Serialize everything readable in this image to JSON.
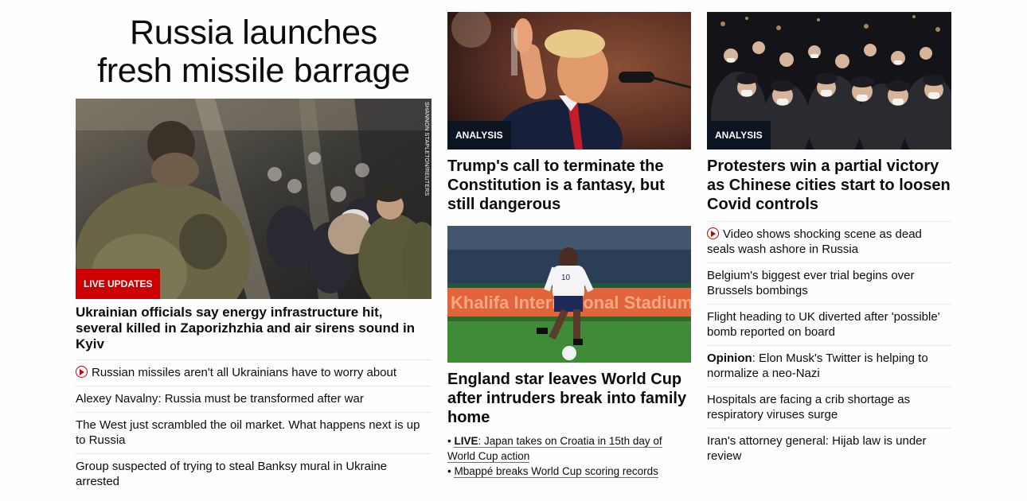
{
  "lead": {
    "title_line1": "Russia launches",
    "title_line2": "fresh missile barrage",
    "badge": "LIVE UPDATES",
    "photo_credit": "SHANNON STAPLETON/REUTERS",
    "headline": "Ukrainian officials say energy infrastructure hit, several killed in Zaporizhzhia and air sirens sound in Kyiv",
    "items": [
      {
        "text": "Russian missiles aren't all Ukrainians have to worry about",
        "video": true
      },
      {
        "text": "Alexey Navalny: Russia must be transformed after war",
        "video": false
      },
      {
        "text": "The West just scrambled the oil market. What happens next is up to Russia",
        "video": false
      },
      {
        "text": "Group suspected of trying to steal Banksy mural in Ukraine arrested",
        "video": false
      }
    ]
  },
  "middle": {
    "story1": {
      "badge": "ANALYSIS",
      "headline": "Trump's call to terminate the Constitution is a fantasy, but still dangerous"
    },
    "story2": {
      "stadium_text": "Khalifa International Stadium",
      "shirt_number": "10",
      "headline": "England star leaves World Cup after intruders break into family home",
      "link1_prefix": "LIVE",
      "link1_text": ": Japan takes on Croatia in 15th day of World Cup action",
      "link2_text": "Mbappé breaks World Cup scoring records"
    }
  },
  "right": {
    "badge": "ANALYSIS",
    "headline": "Protesters win a partial victory as Chinese cities start to loosen Covid controls",
    "items": [
      {
        "text": "Video shows shocking scene as dead seals wash ashore in Russia",
        "video": true
      },
      {
        "text": "Belgium's biggest ever trial begins over Brussels bombings"
      },
      {
        "text": "Flight heading to UK diverted after 'possible' bomb reported on board"
      },
      {
        "prefix": "Opinion",
        "text": ": Elon Musk's Twitter is helping to normalize a neo-Nazi"
      },
      {
        "text": "Hospitals are facing a crib shortage as respiratory viruses surge"
      },
      {
        "text": "Iran's attorney general: Hijab law is under review"
      }
    ]
  },
  "colors": {
    "live_red": "#cc0000",
    "analysis_navy": "#0b1521",
    "text": "#0c0c0c",
    "divider": "#e6e6e6"
  }
}
